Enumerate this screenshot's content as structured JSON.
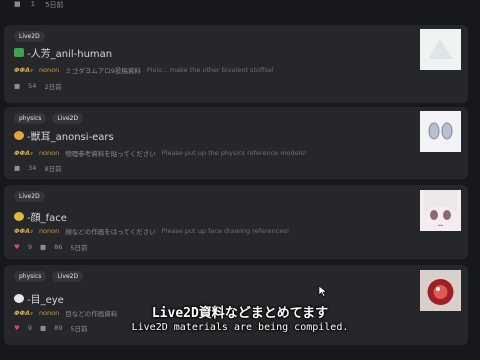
{
  "top": {
    "comments": "1",
    "time": "5日前"
  },
  "cards": [
    {
      "tags": [
        "Live2D"
      ],
      "title": "-人芳_anil-human",
      "logo": "ΦΦA₇",
      "author": "nonon",
      "desc": "ミゴダヨムアロ9投稿資料",
      "desc_en": "Pixiv... make the other bivalent stoffsel",
      "stats": {
        "comments": "54",
        "time": "2日前"
      },
      "thumb_color": "#e8eef0"
    },
    {
      "tags": [
        "physics",
        "Live2D"
      ],
      "title": "-獣耳_anonsi-ears",
      "logo": "ΦΦA₇",
      "author": "nonon",
      "desc": "物理参考資料を貼ってください",
      "desc_en": "Please put up the physics reference models!",
      "stats": {
        "comments": "34",
        "time": "8日前"
      },
      "thumb_color": "#f2f2f4"
    },
    {
      "tags": [
        "Live2D"
      ],
      "title": "-顔_face",
      "logo": "ΦΦA₇",
      "author": "nonon",
      "desc": "顔などの作画をはってください",
      "desc_en": "Please put up face drawing references!",
      "stats": {
        "likes": "9",
        "comments": "86",
        "time": "5日前"
      },
      "thumb_color": "#f1e6ea"
    },
    {
      "tags": [
        "physics",
        "Live2D"
      ],
      "title": "-目_eye",
      "logo": "ΦΦA₇",
      "author": "nonon",
      "desc": "目などの作画資料",
      "desc_en": "Eye reference materials",
      "stats": {
        "likes": "9",
        "comments": "89",
        "time": "5日前"
      },
      "thumb_color": "#c8494a"
    }
  ],
  "subtitle": {
    "jp": "Live2D資料などまとめてます",
    "en": "Live2D materials are being compiled."
  }
}
